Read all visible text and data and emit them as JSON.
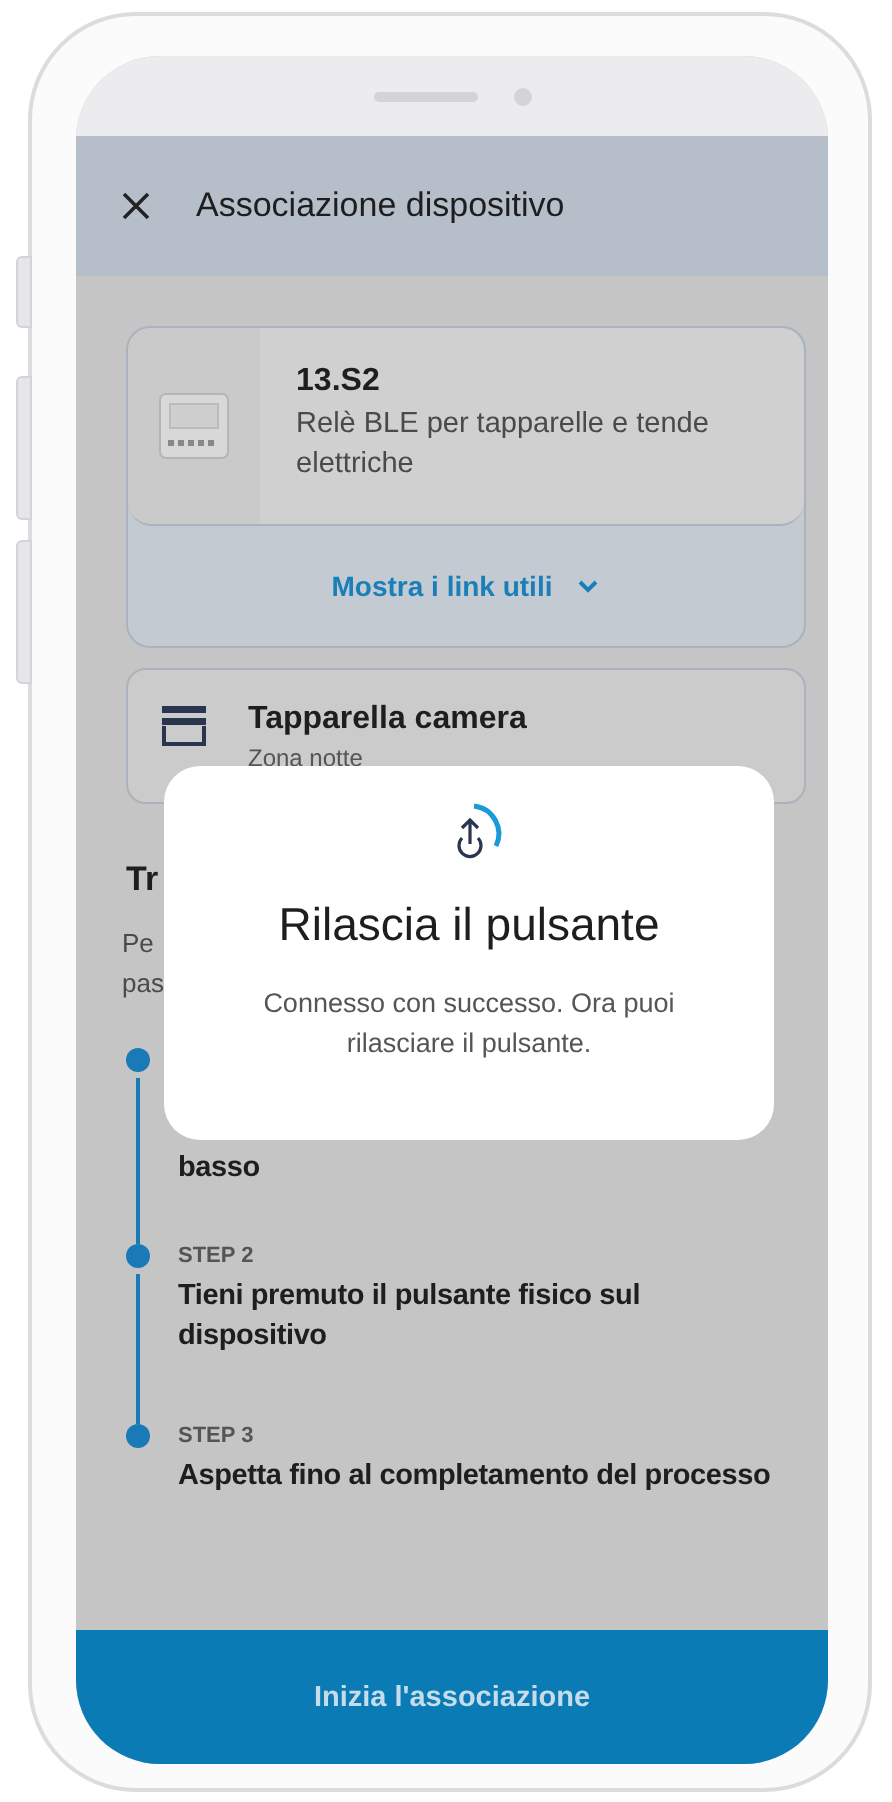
{
  "header": {
    "title": "Associazione dispositivo"
  },
  "device": {
    "model": "13.S2",
    "description": "Relè BLE per tapparelle e tende elettriche",
    "links_toggle": "Mostra i link utili",
    "expanded": false
  },
  "room": {
    "name": "Tapparella camera",
    "zone": "Zona notte"
  },
  "section": {
    "heading": "Tr",
    "intro_lines": [
      "Pe",
      "pas"
    ]
  },
  "steps": [
    {
      "text": "basso"
    },
    {
      "label": "STEP 2",
      "text": "Tieni premuto il pulsante fisico sul dispositivo"
    },
    {
      "label": "STEP 3",
      "text": "Aspetta fino al completamento del processo"
    }
  ],
  "modal": {
    "title": "Rilascia il pulsante",
    "message": "Connesso con successo. Ora puoi rilasciare il pulsante."
  },
  "primary_button": "Inizia l'associazione"
}
